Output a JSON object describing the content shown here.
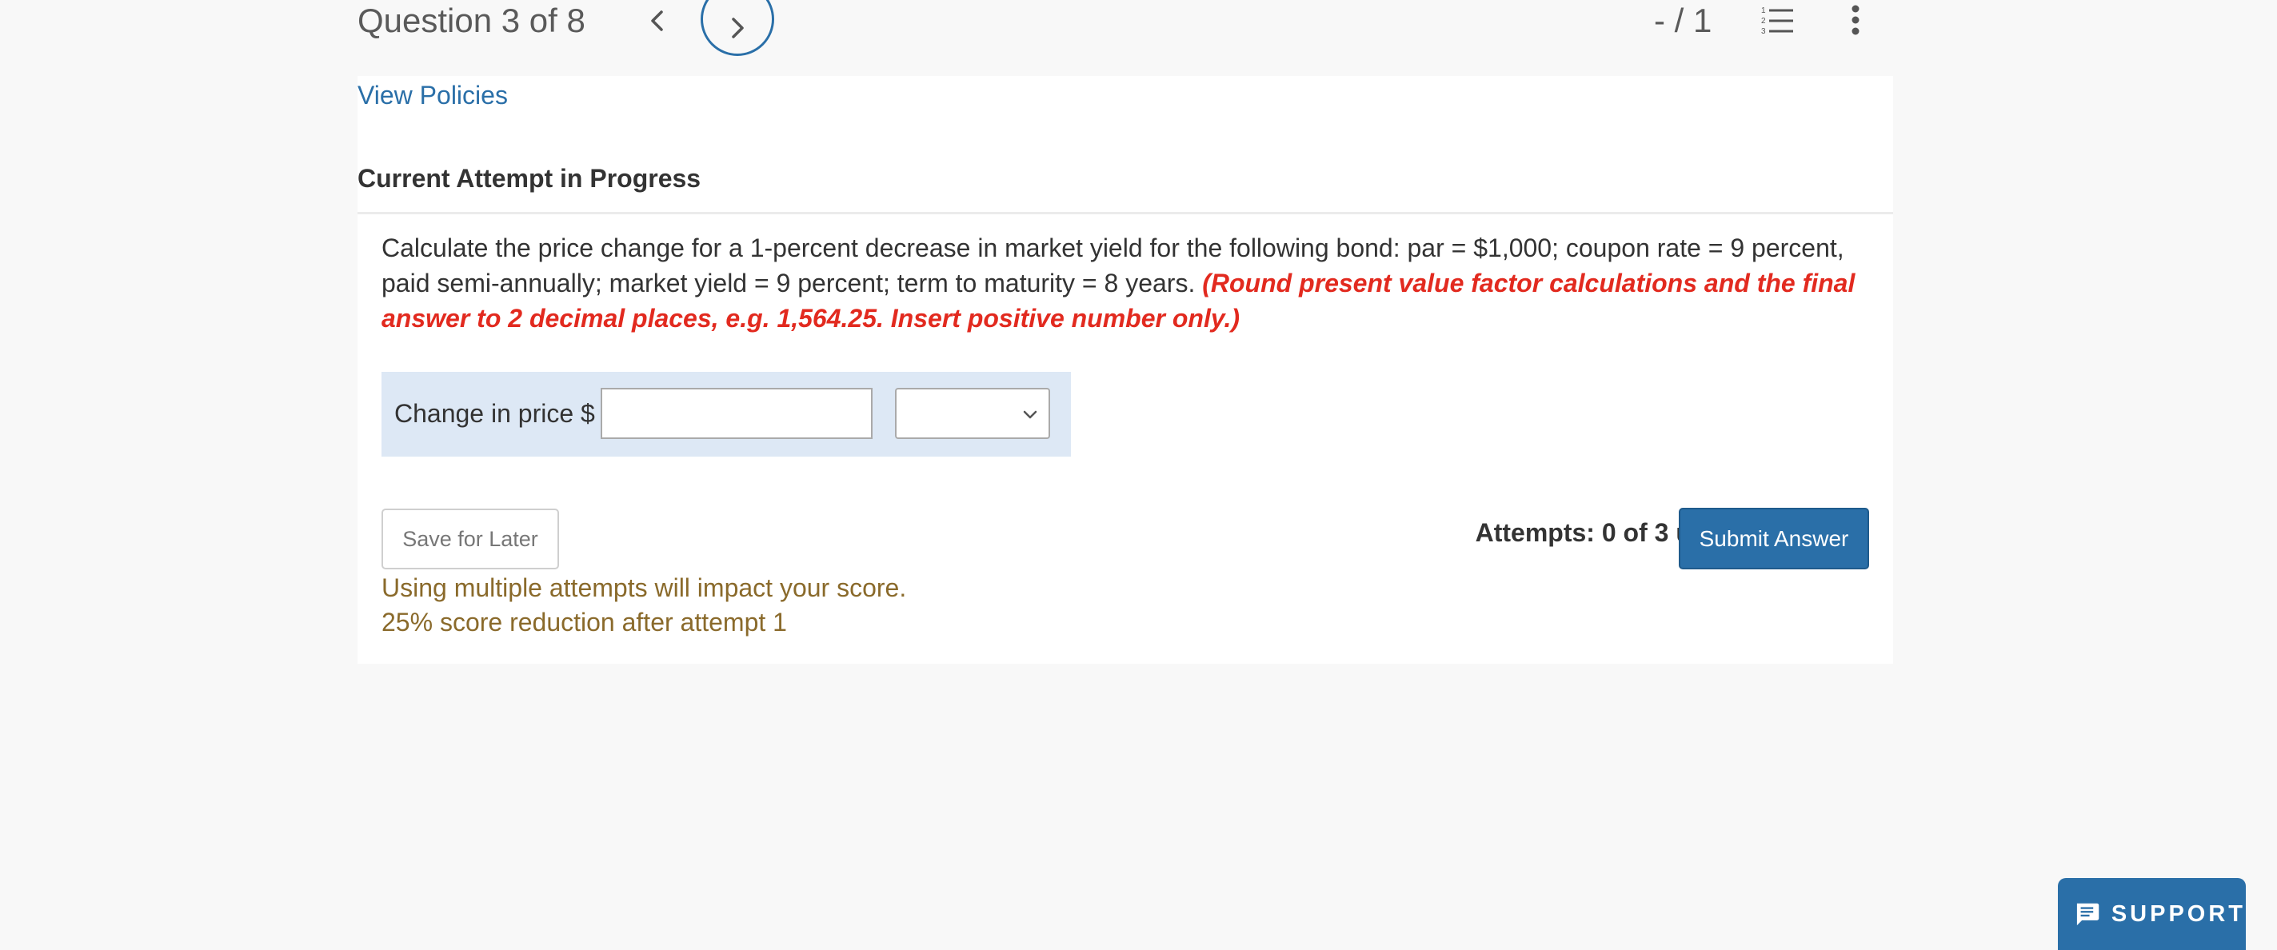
{
  "header": {
    "question_position": "Question 3 of 8",
    "score": "- / 1",
    "prev_icon": "chevron-left-icon",
    "next_icon": "chevron-right-icon",
    "list_icon": "numbered-list-icon",
    "more_icon": "more-vertical-icon"
  },
  "main": {
    "policies_link": "View Policies",
    "attempt_heading": "Current Attempt in Progress",
    "question": {
      "body": "Calculate the price change for a 1-percent decrease in market yield for the following bond: par = $1,000; coupon rate = 9 percent, paid semi-annually; market yield = 9 percent; term to maturity = 8 years. ",
      "hint": "(Round present value factor calculations and the final answer to 2 decimal places, e.g. 1,564.25. Insert positive number only.)"
    },
    "answer": {
      "label": "Change in price $",
      "input_value": "",
      "select_value": ""
    },
    "save_button": "Save for Later",
    "attempts_text": "Attempts: 0 of 3 used",
    "submit_button": "Submit Answer",
    "warning_line1": "Using multiple attempts will impact your score.",
    "warning_line2": "25% score reduction after attempt 1"
  },
  "support": {
    "label": "SUPPORT",
    "icon": "chat-bubble-icon"
  },
  "colors": {
    "accent": "#2a6fa8",
    "hint_red": "#e22a1f",
    "warning_brown": "#8a6a2b",
    "answer_row_bg": "#dde8f5",
    "page_bg": "#f8f8f8"
  }
}
